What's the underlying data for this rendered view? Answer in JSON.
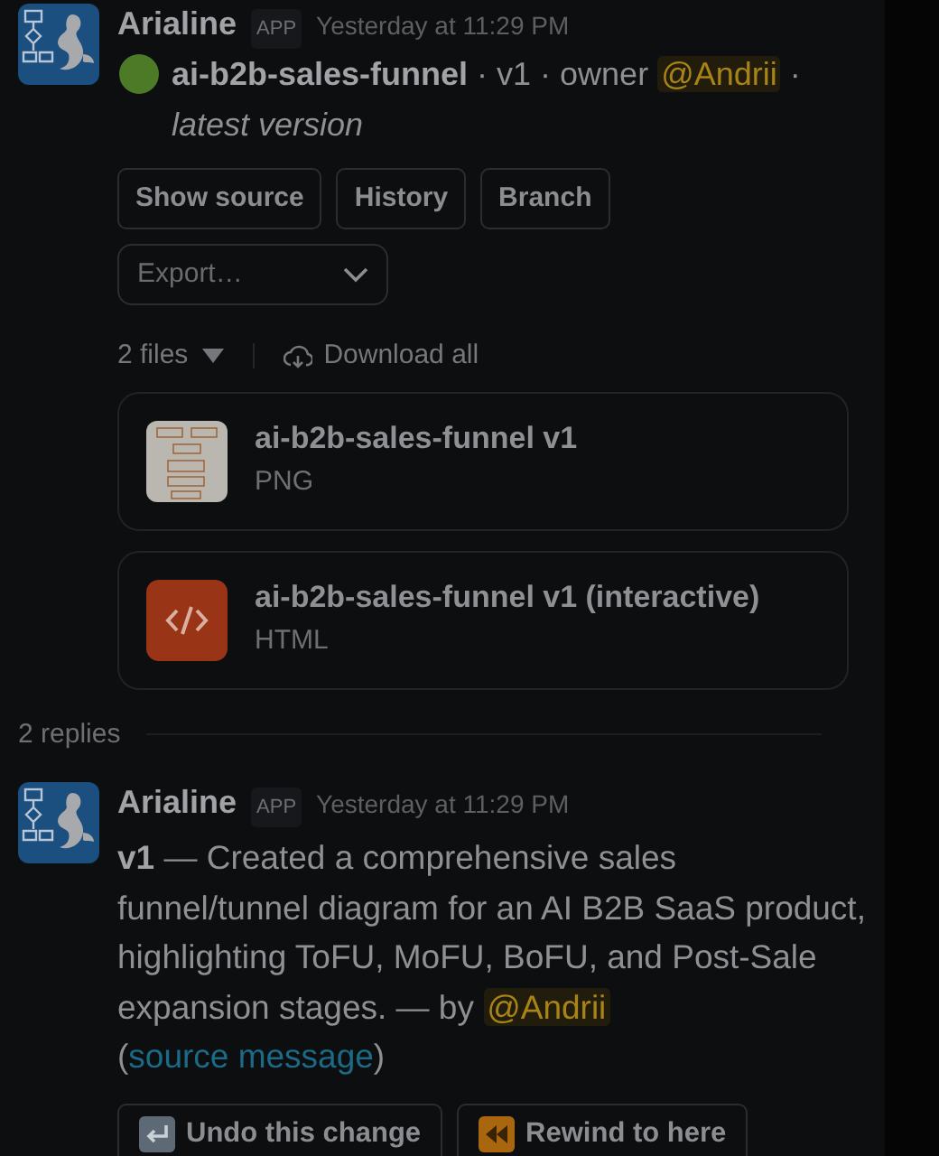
{
  "parent_message": {
    "author": "Arialine",
    "badge": "APP",
    "time": "Yesterday at 11:29 PM",
    "summary_before": "**ai-b2b-sales-funnel** · v1 · owner ",
    "summary_mention": "@Andrii",
    "summary_after": " · *latest version*",
    "buttons": [
      "Show source",
      "History",
      "Branch"
    ],
    "export": {
      "placeholder": "Export…"
    },
    "files_toggle": "2 files",
    "download_all": "Download all",
    "files": [
      {
        "name": "ai-b2b-sales-funnel v1",
        "type": "PNG",
        "kind": "image"
      },
      {
        "name": "ai-b2b-sales-funnel v1 (interactive)",
        "type": "HTML",
        "kind": "code"
      }
    ]
  },
  "replies_divider": "2 replies",
  "reply": {
    "author": "Arialine",
    "badge": "APP",
    "time": "Yesterday at 11:29 PM",
    "text": "**v1** — Created a comprehensive sales funnel/tunnel diagram for an AI B2B SaaS product, highlighting ToFU, MoFU, BoFU, and Post-Sale expansion stages. — by ",
    "mention": "@Andrii",
    "open": "(",
    "link": "source message",
    "close": ")",
    "actions": [
      {
        "label": "Undo this change",
        "kind": "undo"
      },
      {
        "label": "Rewind to here",
        "kind": "rewind"
      }
    ]
  }
}
